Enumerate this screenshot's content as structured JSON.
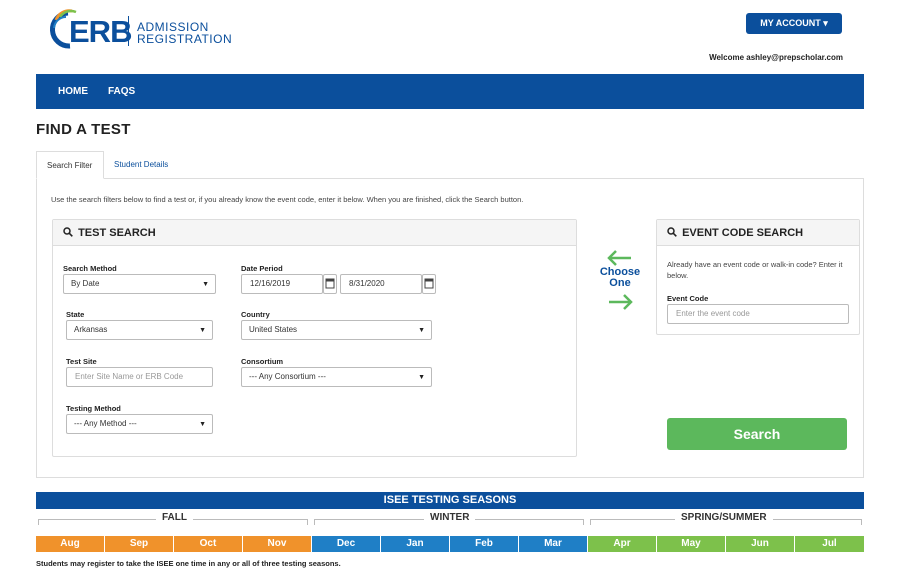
{
  "brand": {
    "logo_text": "ERB",
    "logo_sub_line1": "ADMISSION",
    "logo_sub_line2": "REGISTRATION",
    "primary_color": "#0b4f9c",
    "green": "#5cb85c",
    "orange": "#f0922b",
    "blue": "#1f7fc6",
    "light_green": "#7dc14b"
  },
  "header": {
    "account_button": "MY ACCOUNT ▾",
    "welcome": "Welcome ashley@prepscholar.com"
  },
  "nav": {
    "items": [
      "HOME",
      "FAQS"
    ]
  },
  "page": {
    "title": "FIND A TEST",
    "tabs": [
      "Search Filter",
      "Student Details"
    ],
    "instructions": "Use the search filters below to find a test or, if you already know the event code, enter it below. When you are finished, click the Search button."
  },
  "test_search": {
    "heading": "TEST SEARCH",
    "search_method_label": "Search Method",
    "search_method_value": "By Date",
    "date_period_label": "Date Period",
    "date_from": "12/16/2019",
    "date_to": "8/31/2020",
    "state_label": "State",
    "state_value": "Arkansas",
    "country_label": "Country",
    "country_value": "United States",
    "test_site_label": "Test Site",
    "test_site_placeholder": "Enter Site Name or ERB Code",
    "consortium_label": "Consortium",
    "consortium_value": "--- Any Consortium ---",
    "testing_method_label": "Testing Method",
    "testing_method_value": "--- Any Method ---"
  },
  "choose": {
    "line1": "Choose",
    "line2": "One"
  },
  "event_code_search": {
    "heading": "EVENT CODE SEARCH",
    "description": "Already have an event code or walk-in code? Enter it below.",
    "field_label": "Event Code",
    "placeholder": "Enter the event code"
  },
  "search_button": "Search",
  "seasons": {
    "title": "ISEE TESTING SEASONS",
    "names": [
      "FALL",
      "WINTER",
      "SPRING/SUMMER"
    ],
    "months": [
      "Aug",
      "Sep",
      "Oct",
      "Nov",
      "Dec",
      "Jan",
      "Feb",
      "Mar",
      "Apr",
      "May",
      "Jun",
      "Jul"
    ],
    "footnote": "Students may register to take the ISEE one time in any or all of three testing seasons."
  }
}
